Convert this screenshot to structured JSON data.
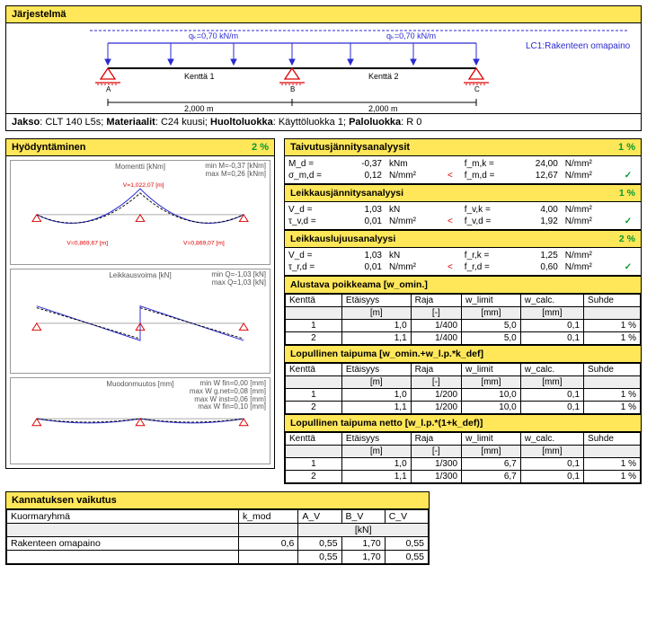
{
  "system": {
    "title": "Järjestelmä",
    "load_label": "qₖ=0,70 kN/m",
    "span1_label": "Kenttä 1",
    "span2_label": "Kenttä 2",
    "span1_len": "2,000 m",
    "span2_len": "2,000 m",
    "lc_label": "LC1:Rakenteen omapaino",
    "node_a": "A",
    "node_b": "B",
    "node_c": "C",
    "jakso_prefix": "Jakso",
    "jakso_val": "CLT 140 L5s",
    "mat_prefix": "Materiaalit",
    "mat_val": "C24 kuusi",
    "huolto_prefix": "Huoltoluokka",
    "huolto_val": "Käyttöluokka 1",
    "palo_prefix": "Paloluokka",
    "palo_val": "R 0"
  },
  "util": {
    "title": "Hyödyntäminen",
    "pct": "2 %",
    "d1_title": "Momentti [kNm]",
    "d1_ann1": "min M=-0,37 [kNm]",
    "d1_ann2": "max M=0,26 [kNm]",
    "d2_title": "Leikkausvoima [kN]",
    "d2_ann1": "min Q=-1,03 [kN]",
    "d2_ann2": "max Q=1,03 [kN]",
    "d3_title": "Muodonmuutos [mm]",
    "d3_ann1": "min W fin=0,00 [mm]",
    "d3_ann2": "max W g.net=0,08 [mm]",
    "d3_ann3": "max W inst=0,06 [mm]",
    "d3_ann4": "max W fin=0,10 [mm]"
  },
  "bend": {
    "title": "Taivutusjännitysanalyysit",
    "pct": "1 %",
    "r1_sym": "M_d =",
    "r1_val": "-0,37",
    "r1_unit": "kNm",
    "r1b_sym": "f_m,k =",
    "r1b_val": "24,00",
    "r1b_unit": "N/mm²",
    "r2_sym": "σ_m,d =",
    "r2_val": "0,12",
    "r2_unit": "N/mm²",
    "r2_op": "<",
    "r2b_sym": "f_m,d =",
    "r2b_val": "12,67",
    "r2b_unit": "N/mm²"
  },
  "shear": {
    "title": "Leikkausjännitysanalyysi",
    "pct": "1 %",
    "r1_sym": "V_d =",
    "r1_val": "1,03",
    "r1_unit": "kN",
    "r1b_sym": "f_v,k =",
    "r1b_val": "4,00",
    "r1b_unit": "N/mm²",
    "r2_sym": "τ_v,d =",
    "r2_val": "0,01",
    "r2_unit": "N/mm²",
    "r2_op": "<",
    "r2b_sym": "f_v,d =",
    "r2b_val": "1,92",
    "r2b_unit": "N/mm²"
  },
  "roll": {
    "title": "Leikkauslujuusanalyysi",
    "pct": "2 %",
    "r1_sym": "V_d =",
    "r1_val": "1,03",
    "r1_unit": "kN",
    "r1b_sym": "f_r,k =",
    "r1b_val": "1,25",
    "r1b_unit": "N/mm²",
    "r2_sym": "τ_r,d =",
    "r2_val": "0,01",
    "r2_unit": "N/mm²",
    "r2_op": "<",
    "r2b_sym": "f_r,d =",
    "r2b_val": "0,60",
    "r2b_unit": "N/mm²"
  },
  "def_hdr": {
    "kentta": "Kenttä",
    "etaisyys": "Etäisyys",
    "raja": "Raja",
    "wlimit": "w_limit",
    "wcalc": "w_calc.",
    "suhde": "Suhde",
    "u_m": "[m]",
    "u_dash": "[-]",
    "u_mm": "[mm]"
  },
  "def1": {
    "title": "Alustava poikkeama [w_omin.]",
    "rows": [
      {
        "k": "1",
        "e": "1,0",
        "r": "1/400",
        "wl": "5,0",
        "wc": "0,1",
        "s": "1 %"
      },
      {
        "k": "2",
        "e": "1,1",
        "r": "1/400",
        "wl": "5,0",
        "wc": "0,1",
        "s": "1 %"
      }
    ]
  },
  "def2": {
    "title": "Lopullinen taipuma [w_omin.+w_l.p.*k_def]",
    "rows": [
      {
        "k": "1",
        "e": "1,0",
        "r": "1/200",
        "wl": "10,0",
        "wc": "0,1",
        "s": "1 %"
      },
      {
        "k": "2",
        "e": "1,1",
        "r": "1/200",
        "wl": "10,0",
        "wc": "0,1",
        "s": "1 %"
      }
    ]
  },
  "def3": {
    "title": "Lopullinen taipuma netto [w_l.p.*(1+k_def)]",
    "rows": [
      {
        "k": "1",
        "e": "1,0",
        "r": "1/300",
        "wl": "6,7",
        "wc": "0,1",
        "s": "1 %"
      },
      {
        "k": "2",
        "e": "1,1",
        "r": "1/300",
        "wl": "6,7",
        "wc": "0,1",
        "s": "1 %"
      }
    ]
  },
  "support": {
    "title": "Kannatuksen vaikutus",
    "h_group": "Kuormaryhmä",
    "h_kmod": "k_mod",
    "h_av": "A_V",
    "h_bv": "B_V",
    "h_cv": "C_V",
    "unit": "[kN]",
    "group": "Rakenteen omapaino",
    "kmod": "0,6",
    "r1_av": "0,55",
    "r1_bv": "1,70",
    "r1_cv": "0,55",
    "r2_av": "0,55",
    "r2_bv": "1,70",
    "r2_cv": "0,55"
  }
}
